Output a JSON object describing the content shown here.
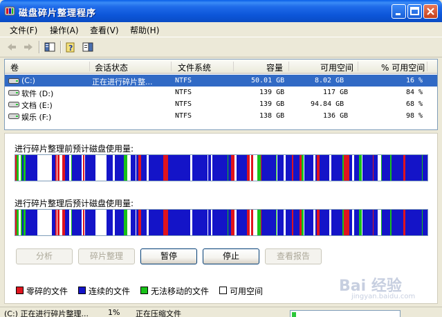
{
  "window": {
    "title": "磁盘碎片整理程序"
  },
  "menu": [
    {
      "label": "文件(F)"
    },
    {
      "label": "操作(A)"
    },
    {
      "label": "查看(V)"
    },
    {
      "label": "帮助(H)"
    }
  ],
  "toolbar": {
    "icons": [
      "back-arrow-icon",
      "forward-arrow-icon",
      "console-tree-icon",
      "help-icon",
      "properties-icon"
    ]
  },
  "list": {
    "headers": [
      "卷",
      "会话状态",
      "文件系统",
      "容量",
      "可用空间",
      "% 可用空间"
    ],
    "rows": [
      {
        "volume": "(C:)",
        "status": "正在进行碎片整...",
        "fs": "NTFS",
        "capacity": "50.01 GB",
        "free": "8.02 GB",
        "pct": "16 %",
        "selected": true
      },
      {
        "volume": "软件 (D:)",
        "status": "",
        "fs": "NTFS",
        "capacity": "139 GB",
        "free": "117 GB",
        "pct": "84 %",
        "selected": false
      },
      {
        "volume": "文档 (E:)",
        "status": "",
        "fs": "NTFS",
        "capacity": "139 GB",
        "free": "94.84 GB",
        "pct": "68 %",
        "selected": false
      },
      {
        "volume": "娱乐 (F:)",
        "status": "",
        "fs": "NTFS",
        "capacity": "138 GB",
        "free": "136 GB",
        "pct": "98 %",
        "selected": false
      }
    ]
  },
  "maps": {
    "before_label": "进行碎片整理前预计磁盘使用量:",
    "after_label": "进行碎片整理后预计磁盘使用量:"
  },
  "buttons": {
    "analyze": "分析",
    "defrag": "碎片整理",
    "pause": "暂停",
    "stop": "停止",
    "report": "查看报告"
  },
  "legend": {
    "fragmented": "零碎的文件",
    "contiguous": "连续的文件",
    "unmovable": "无法移动的文件",
    "free": "可用空间"
  },
  "colors": {
    "fragmented": "#e0141e",
    "contiguous": "#1414c8",
    "unmovable": "#19c219",
    "free": "#ffffff",
    "selection": "#316ac5"
  },
  "status": {
    "left": "(C:) 正在进行碎片整理...",
    "percent": "1%",
    "right": "正在压缩文件",
    "progress": 0.04
  },
  "watermark": {
    "text": "Bai 经验",
    "sub": "jingyan.baidu.com"
  }
}
